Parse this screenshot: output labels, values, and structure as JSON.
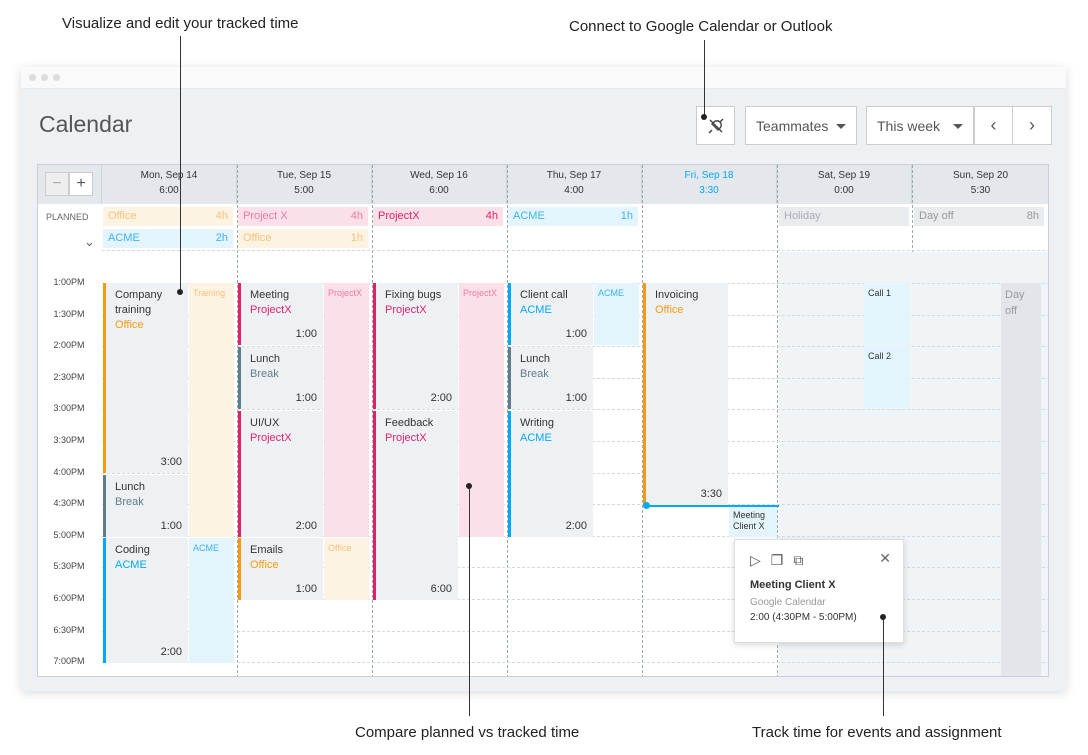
{
  "annotations": {
    "visualize": "Visualize and edit your tracked time",
    "connect": "Connect to Google Calendar or Outlook",
    "compare": "Compare planned vs tracked time",
    "track": "Track time for events and assignment"
  },
  "page": {
    "title": "Calendar"
  },
  "toolbar": {
    "teammates": "Teammates",
    "range": "This week"
  },
  "planned_label": "PLANNED",
  "days": [
    {
      "name": "Mon, Sep 14",
      "total": "6:00"
    },
    {
      "name": "Tue, Sep 15",
      "total": "5:00"
    },
    {
      "name": "Wed, Sep 16",
      "total": "6:00"
    },
    {
      "name": "Thu, Sep 17",
      "total": "4:00"
    },
    {
      "name": "Fri, Sep 18",
      "total": "3:30"
    },
    {
      "name": "Sat, Sep 19",
      "total": "0:00"
    },
    {
      "name": "Sun, Sep 20",
      "total": "5:30"
    }
  ],
  "planned": [
    {
      "project": "Office",
      "hours": "4h"
    },
    {
      "project": "ACME",
      "hours": "2h"
    },
    {
      "project": "Project X",
      "hours": "4h"
    },
    {
      "project": "Office",
      "hours": "1h"
    },
    {
      "project": "ProjectX",
      "hours": "4h"
    },
    {
      "project": "ACME",
      "hours": "1h"
    },
    {
      "project": "Holiday",
      "hours": ""
    },
    {
      "project": "Day off",
      "hours": "8h"
    }
  ],
  "times": [
    "1:00PM",
    "1:30PM",
    "2:00PM",
    "2:30PM",
    "3:00PM",
    "3:30PM",
    "4:00PM",
    "4:30PM",
    "5:00PM",
    "5:30PM",
    "6:00PM",
    "6:30PM",
    "7:00PM"
  ],
  "events": [
    {
      "title": "Company training",
      "project": "Office",
      "duration": "3:00"
    },
    {
      "title": "Lunch",
      "project": "Break",
      "duration": "1:00"
    },
    {
      "title": "Coding",
      "project": "ACME",
      "duration": "2:00"
    },
    {
      "title": "Meeting",
      "project": "ProjectX",
      "duration": "1:00"
    },
    {
      "title": "Lunch",
      "project": "Break",
      "duration": "1:00"
    },
    {
      "title": "UI/UX",
      "project": "ProjectX",
      "duration": "2:00"
    },
    {
      "title": "Emails",
      "project": "Office",
      "duration": "1:00"
    },
    {
      "title": "Fixing bugs",
      "project": "ProjectX",
      "duration": "2:00"
    },
    {
      "title": "Feedback",
      "project": "ProjectX",
      "duration": "6:00"
    },
    {
      "title": "Client call",
      "project": "ACME",
      "duration": "1:00"
    },
    {
      "title": "Lunch",
      "project": "Break",
      "duration": "1:00"
    },
    {
      "title": "Writing",
      "project": "ACME",
      "duration": "2:00"
    },
    {
      "title": "Invoicing",
      "project": "Office",
      "duration": "3:30"
    }
  ],
  "tracks": [
    "Training",
    "ACME",
    "ProjectX",
    "Office",
    "ProjectX",
    "ACME",
    "Meeting Client X",
    "Call 1",
    "Call 2",
    "Day off"
  ],
  "popup": {
    "title": "Meeting Client X",
    "source": "Google Calendar",
    "time": "2:00 (4:30PM - 5:00PM)"
  },
  "colors": {
    "office": "#f39c12",
    "acme": "#03a9f4",
    "projectx": "#e0226b",
    "break": "#607d8b"
  }
}
